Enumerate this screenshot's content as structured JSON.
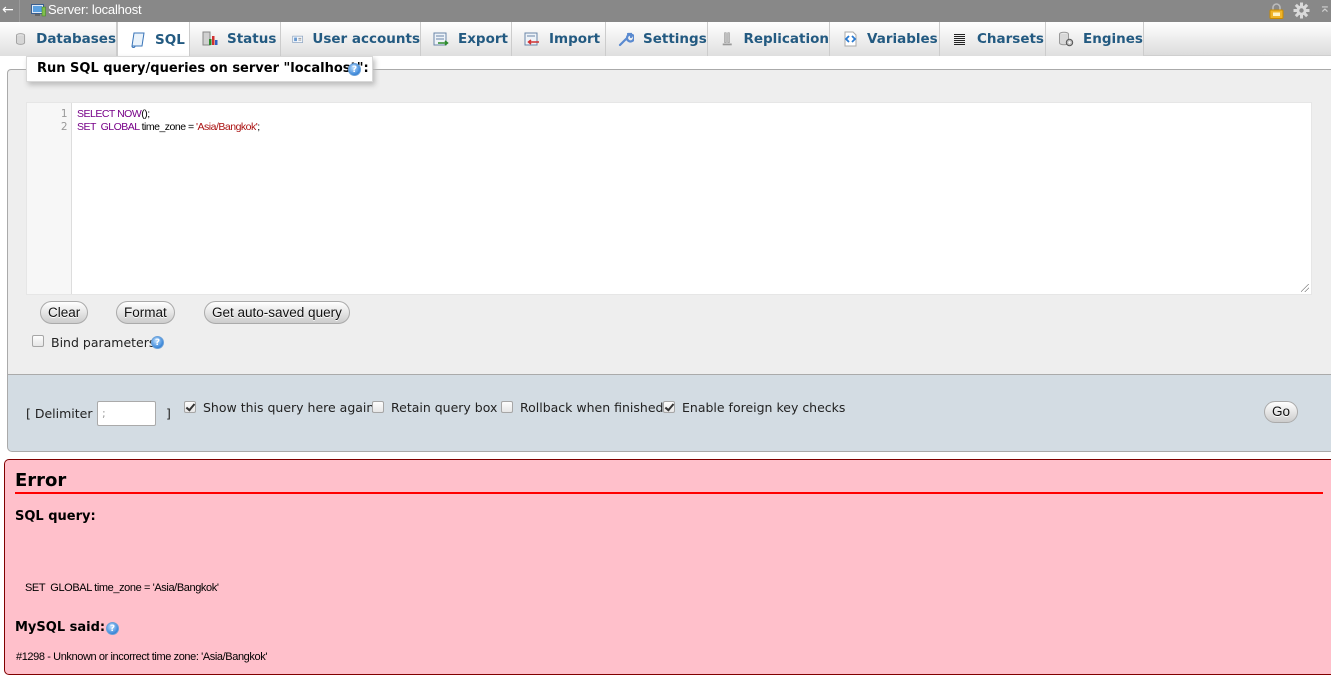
{
  "topbar": {
    "back_icon": "left-arrow-icon",
    "server_icon": "server-icon",
    "title": "Server: localhost",
    "right_icons": [
      "lock-icon",
      "gear-icon",
      "collapse-icon"
    ]
  },
  "tabs": [
    {
      "label": "Databases",
      "icon": "database-icon",
      "active": false
    },
    {
      "label": "SQL",
      "icon": "sql-scroll-icon",
      "active": true
    },
    {
      "label": "Status",
      "icon": "status-chart-icon",
      "active": false
    },
    {
      "label": "User accounts",
      "icon": "user-card-icon",
      "active": false
    },
    {
      "label": "Export",
      "icon": "export-icon",
      "active": false
    },
    {
      "label": "Import",
      "icon": "import-icon",
      "active": false
    },
    {
      "label": "Settings",
      "icon": "wrench-icon",
      "active": false
    },
    {
      "label": "Replication",
      "icon": "replication-icon",
      "active": false
    },
    {
      "label": "Variables",
      "icon": "variables-icon",
      "active": false
    },
    {
      "label": "Charsets",
      "icon": "charsets-icon",
      "active": false
    },
    {
      "label": "Engines",
      "icon": "engines-icon",
      "active": false
    }
  ],
  "query_panel": {
    "legend": "Run SQL query/queries on server \"localhost\":",
    "editor": {
      "line_numbers": [
        "1",
        "2"
      ],
      "lines": [
        [
          {
            "t": "SELECT",
            "c": "kw"
          },
          {
            "t": " "
          },
          {
            "t": "NOW",
            "c": "fn"
          },
          {
            "t": "();"
          }
        ],
        [
          {
            "t": "SET",
            "c": "kw"
          },
          {
            "t": "  "
          },
          {
            "t": "GLOBAL",
            "c": "kw"
          },
          {
            "t": " time_zone = "
          },
          {
            "t": "'Asia/Bangkok'",
            "c": "str"
          },
          {
            "t": ";"
          }
        ]
      ]
    },
    "buttons": {
      "clear": "Clear",
      "format": "Format",
      "get_autosaved": "Get auto-saved query"
    },
    "bind_parameters": {
      "label": "Bind parameters",
      "checked": false
    }
  },
  "options": {
    "delimiter_label_open": "[ Delimiter",
    "delimiter_value": ";",
    "delimiter_label_close": "]",
    "show_query_again": {
      "label": "Show this query here again",
      "checked": true
    },
    "retain_query_box": {
      "label": "Retain query box",
      "checked": false
    },
    "rollback_when_finished": {
      "label": "Rollback when finished",
      "checked": false
    },
    "enable_foreign_key_checks": {
      "label": "Enable foreign key checks",
      "checked": true
    },
    "go_button": "Go"
  },
  "error": {
    "title": "Error",
    "sql_query_heading": "SQL query:",
    "sql_query_text": "SET  GLOBAL time_zone = 'Asia/Bangkok'",
    "mysql_said_heading": "MySQL said:",
    "message": "#1298 - Unknown or incorrect time zone: 'Asia/Bangkok'"
  },
  "colors": {
    "tab_text": "#235a81",
    "error_bg": "#ffc0cb",
    "error_rule": "#ff0000",
    "options_bg": "#d3dce3",
    "topbar_bg": "#888888"
  }
}
